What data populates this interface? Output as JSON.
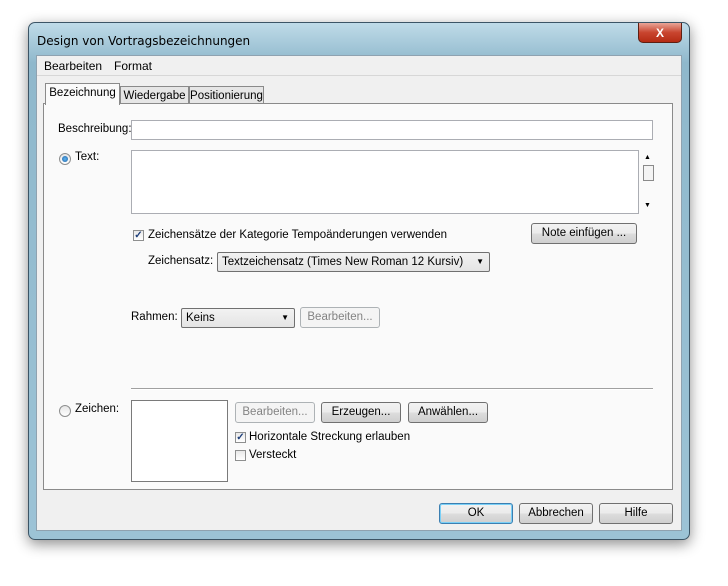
{
  "window": {
    "title": "Design von Vortragsbezeichnungen",
    "close_glyph": "X"
  },
  "menu": [
    "Bearbeiten",
    "Format"
  ],
  "tabs": [
    {
      "label": "Bezeichnung",
      "active": true
    },
    {
      "label": "Wiedergabe",
      "active": false
    },
    {
      "label": "Positionierung",
      "active": false
    }
  ],
  "form": {
    "beschreibung_label": "Beschreibung:",
    "beschreibung_value": "",
    "text_radio_label": "Text:",
    "text_radio_selected": true,
    "text_value": "",
    "kategorie_checkbox_label": "Zeichensätze der Kategorie Tempoänderungen verwenden",
    "kategorie_checked": true,
    "note_button": "Note einfügen ...",
    "zeichensatz_label": "Zeichensatz:",
    "zeichensatz_value": "Textzeichensatz (Times New Roman 12  Kursiv)",
    "rahmen_label": "Rahmen:",
    "rahmen_value": "Keins",
    "rahmen_edit_button": "Bearbeiten...",
    "zeichen_radio_label": "Zeichen:",
    "zeichen_radio_selected": false,
    "zeichen_edit_button": "Bearbeiten...",
    "erzeugen_button": "Erzeugen...",
    "anwaehlen_button": "Anwählen...",
    "horizontal_checkbox_label": "Horizontale Streckung erlauben",
    "horizontal_checked": true,
    "versteckt_checkbox_label": "Versteckt",
    "versteckt_checked": false,
    "check_glyph": "✓"
  },
  "footer": {
    "ok": "OK",
    "cancel": "Abbrechen",
    "help": "Hilfe"
  },
  "icons": {
    "scroll_up": "▲",
    "scroll_down": "▼",
    "dropdown": "▼"
  }
}
